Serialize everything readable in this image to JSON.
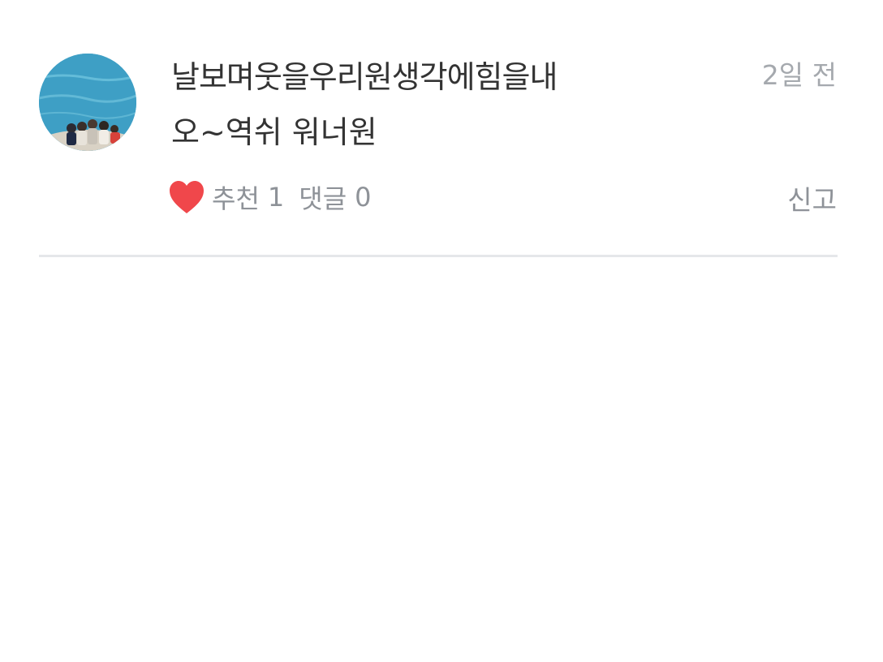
{
  "comment": {
    "avatar_icon": "profile-photo",
    "username": "날보며웃을우리원생각에힘을내",
    "time": "2일 전",
    "content": "오~역쉬 워너원",
    "actions": {
      "like_icon": "heart-icon",
      "like_color": "#f0474b",
      "recommend_label": "추천",
      "recommend_count": "1",
      "reply_label": "댓글",
      "reply_count": "0"
    },
    "report_label": "신고"
  }
}
